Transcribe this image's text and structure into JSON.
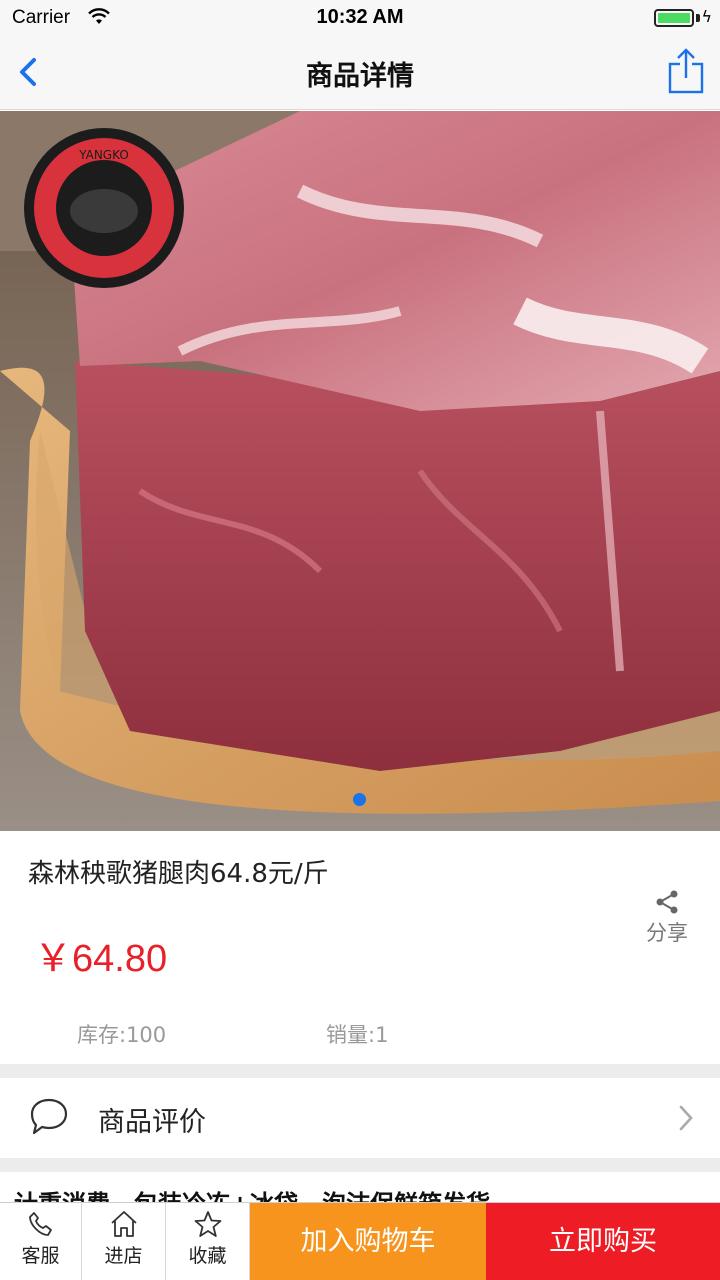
{
  "status_bar": {
    "carrier": "Carrier",
    "time": "10:32 AM",
    "battery_level": 1.0
  },
  "nav": {
    "title": "商品详情",
    "back_icon": "chevron-left-icon",
    "share_icon": "share-upload-icon"
  },
  "product": {
    "image_description_icon": "product-photo",
    "logo_text": "YANGKO DANCE PIG",
    "carousel": {
      "total": 1,
      "current": 1
    },
    "name": "森林秧歌猪腿肉64.8元/斤",
    "price": "￥64.80",
    "share_label": "分享",
    "stock": "库存:100",
    "sales": "销量:1"
  },
  "reviews": {
    "label": "商品评价",
    "icon": "chat-bubble-icon"
  },
  "description": {
    "text": "计重消费，包装冷冻+冰袋，泡沫保鲜箱发货"
  },
  "toolbar": {
    "service_label": "客服",
    "store_label": "进店",
    "favorite_label": "收藏",
    "add_cart_label": "加入购物车",
    "buy_now_label": "立即购买"
  },
  "colors": {
    "accent_blue": "#1a73e8",
    "price_red": "#e8202a",
    "cart_orange": "#f7941d",
    "buy_red": "#ee1c25"
  }
}
